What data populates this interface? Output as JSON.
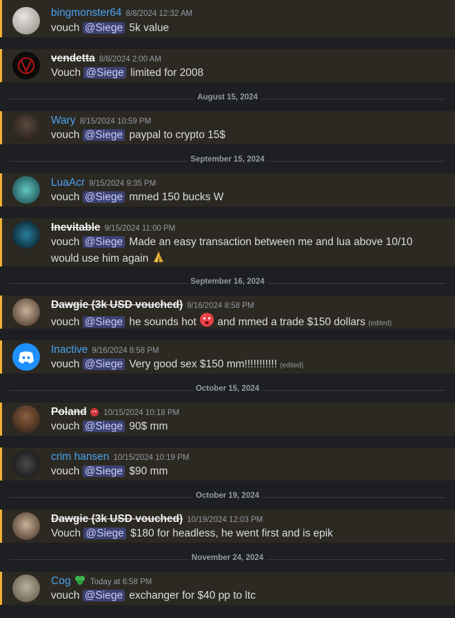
{
  "colors": {
    "mention_bg": "#3c4270",
    "accent_bar": "#f0b232",
    "username_blue": "#4aa3f0"
  },
  "messages": [
    {
      "user": "bingmonster64",
      "timestamp": "8/8/2024 12:32 AM",
      "prefix": "vouch",
      "mention": "@Siege",
      "text": "5k value"
    },
    {
      "user": "vendetta",
      "timestamp": "8/8/2024 2:00 AM",
      "prefix": "Vouch",
      "mention": "@Siege",
      "text": "limited for 2008"
    },
    {
      "user": "Wary",
      "timestamp": "8/15/2024 10:59 PM",
      "prefix": "vouch",
      "mention": "@Siege",
      "text": "paypal to crypto 15$"
    },
    {
      "user": "LuaAcr",
      "timestamp": "9/15/2024 9:35 PM",
      "prefix": "vouch",
      "mention": "@Siege",
      "text": "mmed 150 bucks W"
    },
    {
      "user": "Inevitable",
      "timestamp": "9/15/2024 11:00 PM",
      "prefix": "vouch",
      "mention": "@Siege",
      "text": " Made an easy transaction between me and lua above 10/10",
      "text2": "would use him again"
    },
    {
      "user": "Dawgie (3k USD vouched)",
      "timestamp": "9/16/2024 8:58 PM",
      "prefix": "vouch",
      "mention": "@Siege",
      "text": "he sounds hot",
      "text_after": "and mmed a trade $150 dollars",
      "edited": "(edited)"
    },
    {
      "user": "Inactive",
      "timestamp": "9/16/2024 8:58 PM",
      "prefix": "vouch",
      "mention": "@Siege",
      "text": "Very good sex $150 mm!!!!!!!!!!!",
      "edited": "(edited)"
    },
    {
      "user": "Poland",
      "timestamp": "10/15/2024 10:18 PM",
      "prefix": "vouch",
      "mention": "@Siege",
      "text": " 90$ mm"
    },
    {
      "user": "crim hansen",
      "timestamp": "10/15/2024 10:19 PM",
      "prefix": "vouch",
      "mention": "@Siege",
      "text": "$90 mm"
    },
    {
      "user": "Dawgie (3k USD vouched)",
      "timestamp": "10/19/2024 12:03 PM",
      "prefix": "Vouch",
      "mention": "@Siege",
      "text": "$180 for headless, he went first and is epik"
    },
    {
      "user": "Cog",
      "timestamp": "Today at 6:58 PM",
      "prefix": "vouch",
      "mention": "@Siege",
      "text": "exchanger for $40 pp to ltc"
    }
  ],
  "dividers": [
    "August 15, 2024",
    "September 15, 2024",
    "September 16, 2024",
    "October 15, 2024",
    "October 19, 2024",
    "November 24, 2024"
  ]
}
